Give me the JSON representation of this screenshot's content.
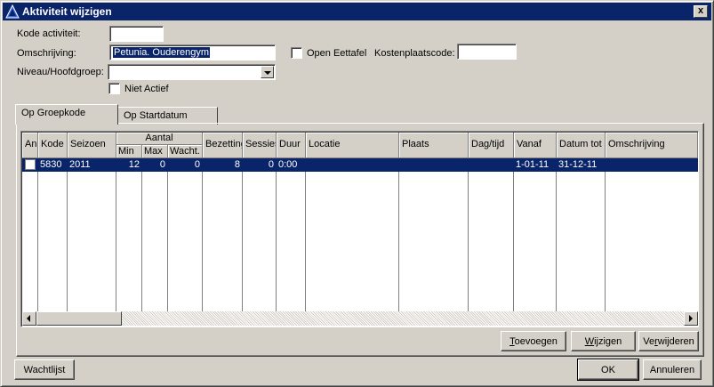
{
  "window": {
    "title": "Aktiviteit wijzigen",
    "close_label": "x"
  },
  "form": {
    "code_label": "Kode activiteit:",
    "code_value": "",
    "description_label": "Omschrijving:",
    "description_value": "Petunia. Ouderengym",
    "open_eettafel_label": "Open Eettafel",
    "kostenplaats_label": "Kostenplaatscode:",
    "kostenplaats_value": "",
    "niveau_label": "Niveau/Hoofdgroep:",
    "niveau_value": "",
    "niet_actief_label": "Niet Actief"
  },
  "tabs": [
    {
      "label": "Op Groepkode",
      "active": true
    },
    {
      "label": "Op Startdatum",
      "active": false
    }
  ],
  "table": {
    "columns": [
      "Ani",
      "Kode",
      "Seizoen",
      "Aantal",
      "Min",
      "Max",
      "Wacht.",
      "Bezetting",
      "Sessies",
      "Duur",
      "Locatie",
      "Plaats",
      "Dag/tijd",
      "Vanaf",
      "Datum tot",
      "Omschrijving"
    ],
    "rows": [
      {
        "kode": "5830",
        "seizoen": "2011",
        "min": "12",
        "max": "0",
        "wacht": "0",
        "bezetting": "8",
        "sessies": "0",
        "duur": "0:00",
        "locatie": "",
        "plaats": "",
        "dagtijd": "",
        "vanaf": "1-01-11",
        "datum_tot": "31-12-11",
        "omschrijving": ""
      }
    ]
  },
  "buttons": {
    "toevoegen_u": "T",
    "toevoegen_rest": "oevoegen",
    "wijzigen_u": "W",
    "wijzigen_rest": "ijzigen",
    "verwijderen_pre": "Ve",
    "verwijderen_u": "r",
    "verwijderen_rest": "wijderen",
    "wachtlijst": "Wachtlijst",
    "ok": "OK",
    "annuleren": "Annuleren"
  },
  "colors": {
    "titlebar": "#0a246a",
    "selection": "#0a246a",
    "face": "#d4d0c8"
  }
}
